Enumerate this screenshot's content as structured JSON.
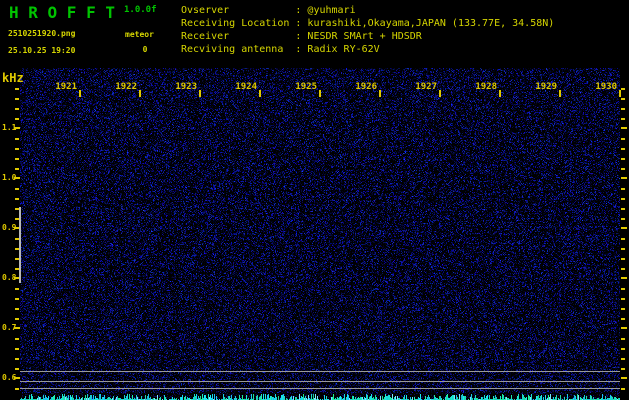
{
  "header": {
    "title": "H R O F F T",
    "version": "1.0.0f",
    "filename": "2510251920.png",
    "meteor_label": "meteor",
    "meteor_count": "0",
    "datetime": "25.10.25 19:20",
    "info": [
      {
        "label": "Ovserver",
        "value": "@yuhmari"
      },
      {
        "label": "Receiving Location",
        "value": "kurashiki,Okayama,JAPAN (133.77E, 34.58N)"
      },
      {
        "label": "Receiver",
        "value": "NESDR SMArt + HDSDR"
      },
      {
        "label": "Recviving antenna",
        "value": "Radix RY-62V"
      }
    ],
    "info_colon_column": 19
  },
  "chart_data": {
    "type": "heatmap",
    "subtype": "radio-meteor-spectrogram",
    "title": "",
    "x_axis": {
      "tick_labels": [
        "1921",
        "1922",
        "1923",
        "1924",
        "1925",
        "1926",
        "1927",
        "1928",
        "1929",
        "1930"
      ],
      "start_time": "19:20",
      "end_time": "19:30",
      "minutes_per_division": 1
    },
    "y_axis": {
      "unit": "kHz",
      "tick_labels": [
        "1.1",
        "1.0",
        "0.9",
        "0.8",
        "0.7",
        "0.6"
      ],
      "range_khz": [
        0.58,
        1.22
      ],
      "minor_step_khz": 0.02
    },
    "content": "uniform dark-blue background noise, no meteor echo traces (meteor count 0)",
    "horizontal_lines_khz": [
      0.614,
      0.594,
      0.58
    ],
    "detection_band_marker_khz": [
      0.792,
      0.942
    ],
    "noise_meter": "cyan amplitude noise bars along bottom strip"
  },
  "colors": {
    "background": "#000000",
    "title_green": "#00c400",
    "header_yellow": "#d6d600",
    "axis_yellow": "#e0ca00",
    "grid_line_gray": "#9a9a9a",
    "band_marker_gray": "#b8b8b8",
    "noise_blue": "#2020c8",
    "meter_cyan": "#30c8d2"
  }
}
